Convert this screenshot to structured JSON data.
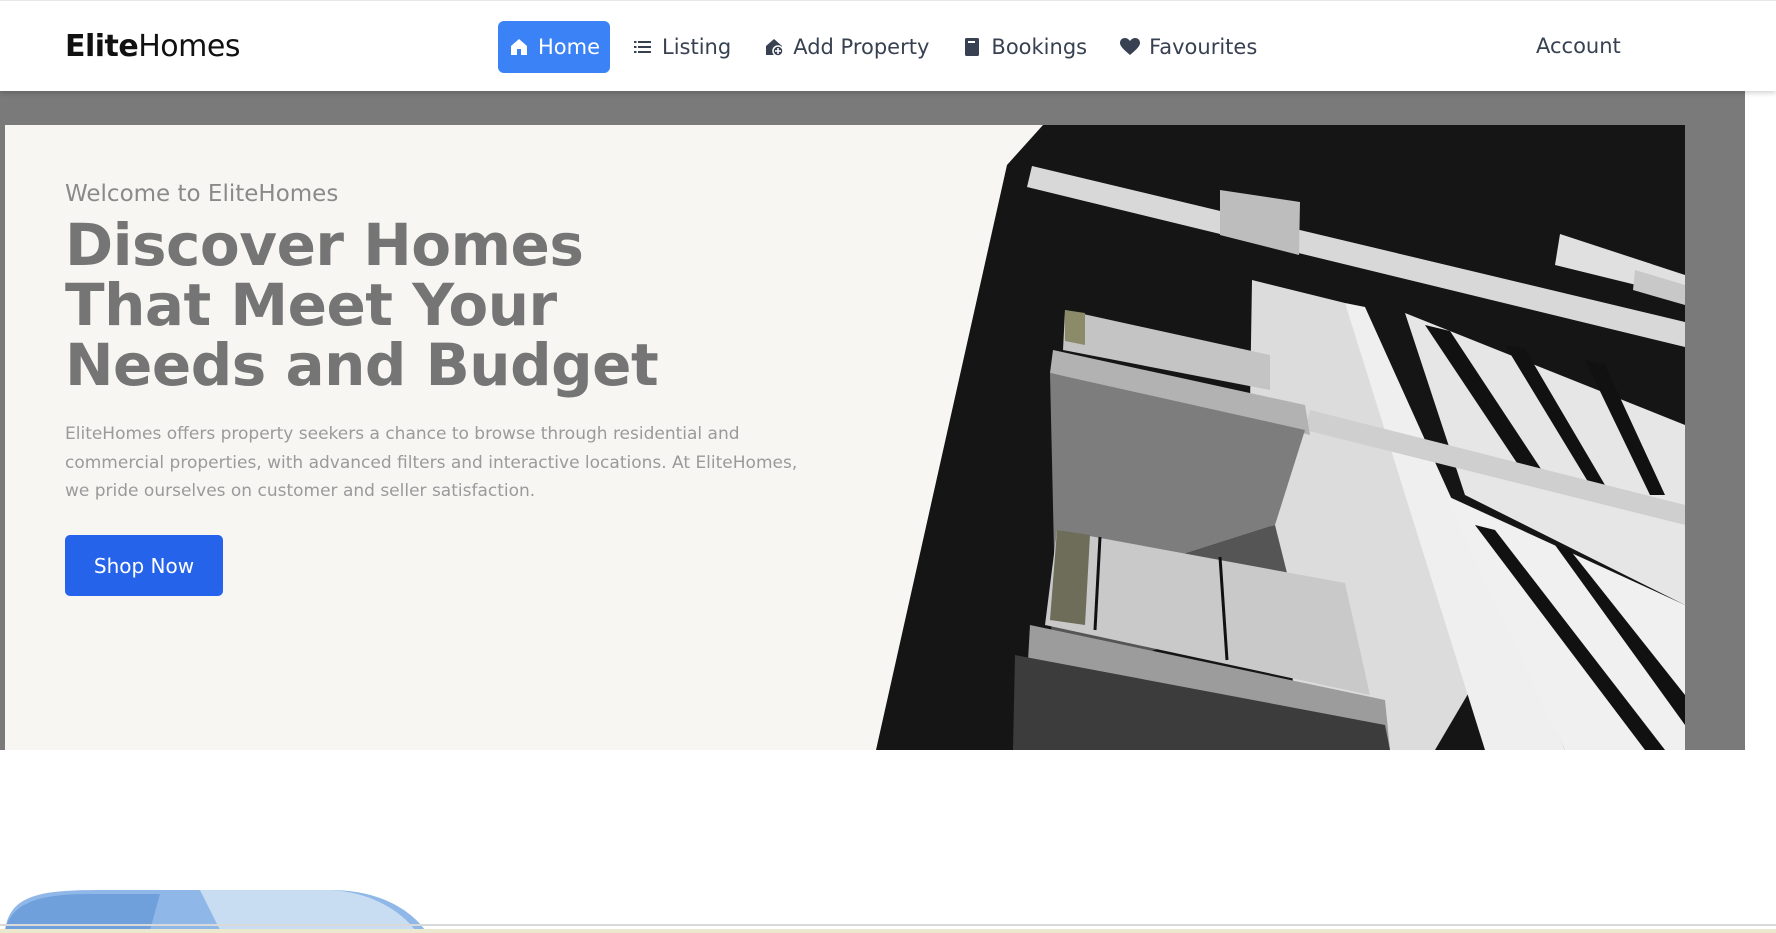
{
  "brand": {
    "strong": "Elite",
    "light": "Homes"
  },
  "nav": {
    "items": [
      {
        "label": "Home",
        "icon": "home-icon",
        "active": true
      },
      {
        "label": "Listing",
        "icon": "list-icon"
      },
      {
        "label": "Add Property",
        "icon": "add-home-icon"
      },
      {
        "label": "Bookings",
        "icon": "book-icon"
      },
      {
        "label": "Favourites",
        "icon": "heart-icon"
      }
    ],
    "account": "Account"
  },
  "hero": {
    "welcome": "Welcome to EliteHomes",
    "headline": "Discover Homes That Meet Your Needs and Budget",
    "description": "EliteHomes offers property seekers a chance to browse through residential and commercial properties, with advanced filters and interactive locations. At EliteHomes, we pride ourselves on customer and seller satisfaction.",
    "cta": "Shop Now"
  },
  "colors": {
    "accent": "#3b82f6",
    "button": "#2563eb",
    "hero_bg": "#f7f6f3",
    "backdrop": "#7a7a7a"
  }
}
